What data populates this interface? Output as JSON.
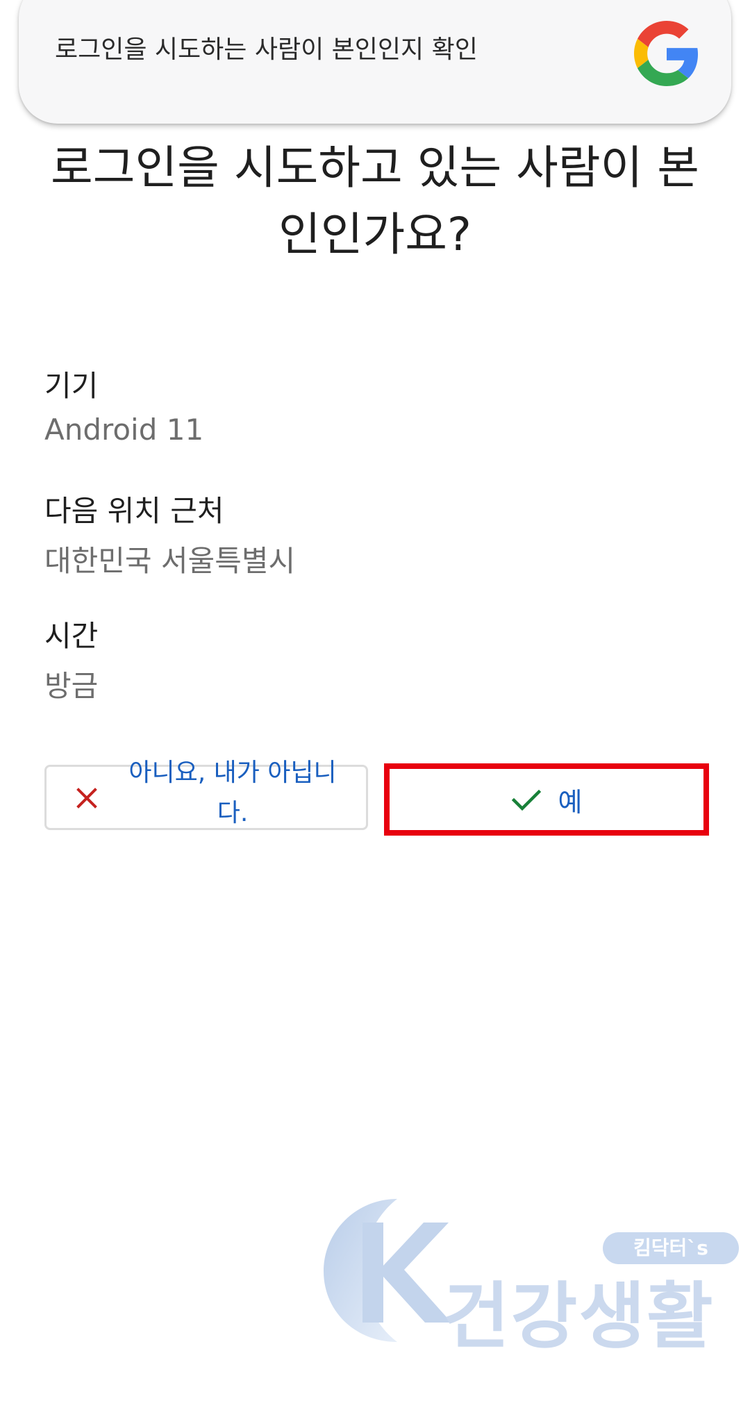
{
  "notification": {
    "text": "로그인을 시도하는 사람이 본인인지 확인",
    "logo_icon": "google-g-icon"
  },
  "title": {
    "line1": "로그인을 시도하고 있는 사람이 본",
    "line2": "인인가요?"
  },
  "details": [
    {
      "label": "기기",
      "value": "Android 11"
    },
    {
      "label": "다음 위치 근처",
      "value": "대한민국 서울특별시"
    },
    {
      "label": "시간",
      "value": "방금"
    }
  ],
  "actions": {
    "deny": {
      "line1": "아니요, 내가 아닙니",
      "line2": "다.",
      "icon": "close-icon"
    },
    "confirm": {
      "label": "예",
      "icon": "check-icon"
    }
  },
  "watermark": {
    "badge": "킴닥터`s",
    "text": "건강생활"
  },
  "colors": {
    "link_blue": "#1a5fbf",
    "deny_red": "#c5221f",
    "confirm_green": "#188038",
    "highlight_border": "#e8000e"
  }
}
